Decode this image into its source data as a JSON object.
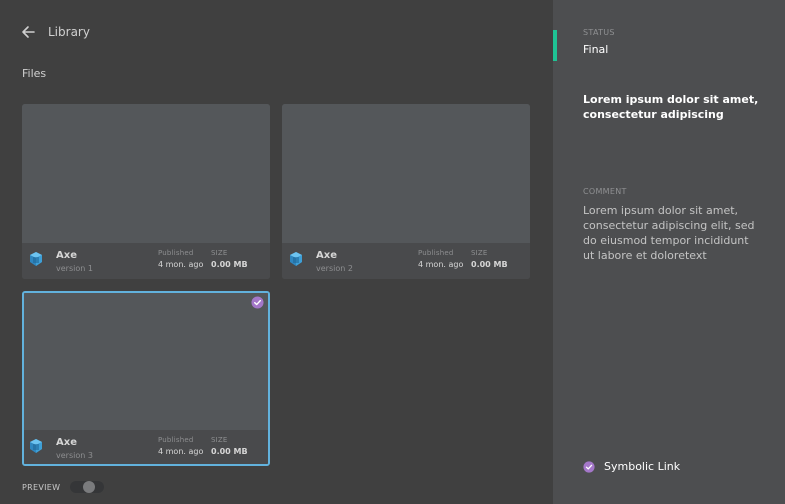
{
  "header": {
    "title": "Library"
  },
  "files_section": {
    "label": "Files"
  },
  "files": [
    {
      "name": "Axe",
      "version": "version 1",
      "published_label": "Published",
      "published_value": "4 mon. ago",
      "size_label": "SIZE",
      "size_value": "0.00 MB",
      "selected": false
    },
    {
      "name": "Axe",
      "version": "version 2",
      "published_label": "Published",
      "published_value": "4 mon. ago",
      "size_label": "SIZE",
      "size_value": "0.00 MB",
      "selected": false
    },
    {
      "name": "Axe",
      "version": "version 3",
      "published_label": "Published",
      "published_value": "4 mon. ago",
      "size_label": "SIZE",
      "size_value": "0.00 MB",
      "selected": true
    }
  ],
  "preview": {
    "label": "PREVIEW",
    "enabled": false
  },
  "details": {
    "status_label": "STATUS",
    "status_value": "Final",
    "description": "Lorem ipsum dolor sit amet, consectetur adipiscing",
    "comment_label": "COMMENT",
    "comment": "Lorem ipsum dolor sit amet, consectetur adipiscing elit, sed do eiusmod tempor incididunt ut labore et doloretext",
    "link_label": "Symbolic Link"
  },
  "colors": {
    "status_accent": "#1fc394",
    "selection_border": "#62b2dd",
    "check_badge": "#a477c9",
    "file_icon": "#3e9fd6"
  },
  "icons": {
    "back": "arrow-left-icon",
    "file": "cube-icon",
    "selected": "check-circle-icon",
    "link": "check-circle-icon"
  }
}
